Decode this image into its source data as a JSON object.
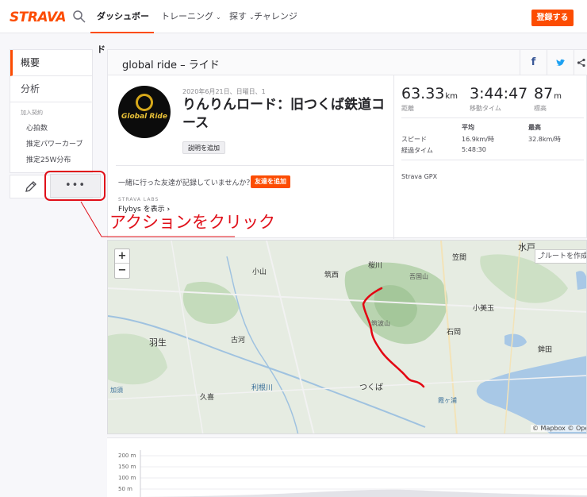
{
  "nav": {
    "logo": "STRAVA",
    "items": [
      {
        "label": "ダッシュボード",
        "chevron": true,
        "active": true
      },
      {
        "label": "トレーニング",
        "chevron": true,
        "active": false
      },
      {
        "label": "探す",
        "chevron": true,
        "active": false
      },
      {
        "label": "チャレンジ",
        "chevron": false,
        "active": false
      }
    ],
    "signup_label": "登録する",
    "accent_color": "#fc4c02"
  },
  "sidebar": {
    "tabs": [
      {
        "label": "概要",
        "active": true
      },
      {
        "label": "分析",
        "active": false
      }
    ],
    "section_label": "加入契約",
    "sub_items": [
      "心拍数",
      "推定パワーカーブ",
      "推定25W分布"
    ],
    "more_label": "•••"
  },
  "activity": {
    "header_title": "global ride – ライド",
    "share": {
      "facebook": "f",
      "twitter": "t",
      "share": "share-icon"
    },
    "avatar_text": "Global Ride",
    "date": "2020年6月21日、日曜日、1",
    "title": "りんりんロード：旧つくば鉄道コース",
    "add_description_label": "説明を追加",
    "friend_question": "一緒に行った友達が記録していませんか？",
    "add_friend_label": "友達を追加",
    "labs_label": "STRAVA LABS",
    "flybys_label": "Flybys を表示"
  },
  "stats": {
    "distance": {
      "value": "63.33",
      "unit": "km",
      "label": "距離"
    },
    "moving_time": {
      "value": "3:44:47",
      "label": "移動タイム"
    },
    "elevation": {
      "value": "87",
      "unit": "m",
      "label": "標高"
    },
    "table": {
      "headers": [
        "平均",
        "最高"
      ],
      "rows": [
        {
          "label": "スピード",
          "avg": "16.9km/時",
          "max": "32.8km/時"
        },
        {
          "label": "経過タイム",
          "avg": "5:48:30",
          "max": ""
        }
      ]
    },
    "device": "Strava GPX"
  },
  "annotation": {
    "callout": "アクションをクリック",
    "color": "#e0101a"
  },
  "map": {
    "zoom_in": "+",
    "zoom_out": "−",
    "route_button": "ルートを作成",
    "places": [
      "水戸",
      "笠間",
      "桜川",
      "筑西",
      "小山",
      "羽生",
      "古河",
      "小美玉",
      "石岡",
      "鉾田",
      "つくば",
      "久喜",
      "利根川",
      "霞ヶ浦",
      "加須",
      "筑波山",
      "吾国山"
    ],
    "attribution": "© Mapbox © Open"
  },
  "elevation_chart": {
    "ticks": [
      "200 m",
      "150 m",
      "100 m",
      "50 m"
    ]
  }
}
